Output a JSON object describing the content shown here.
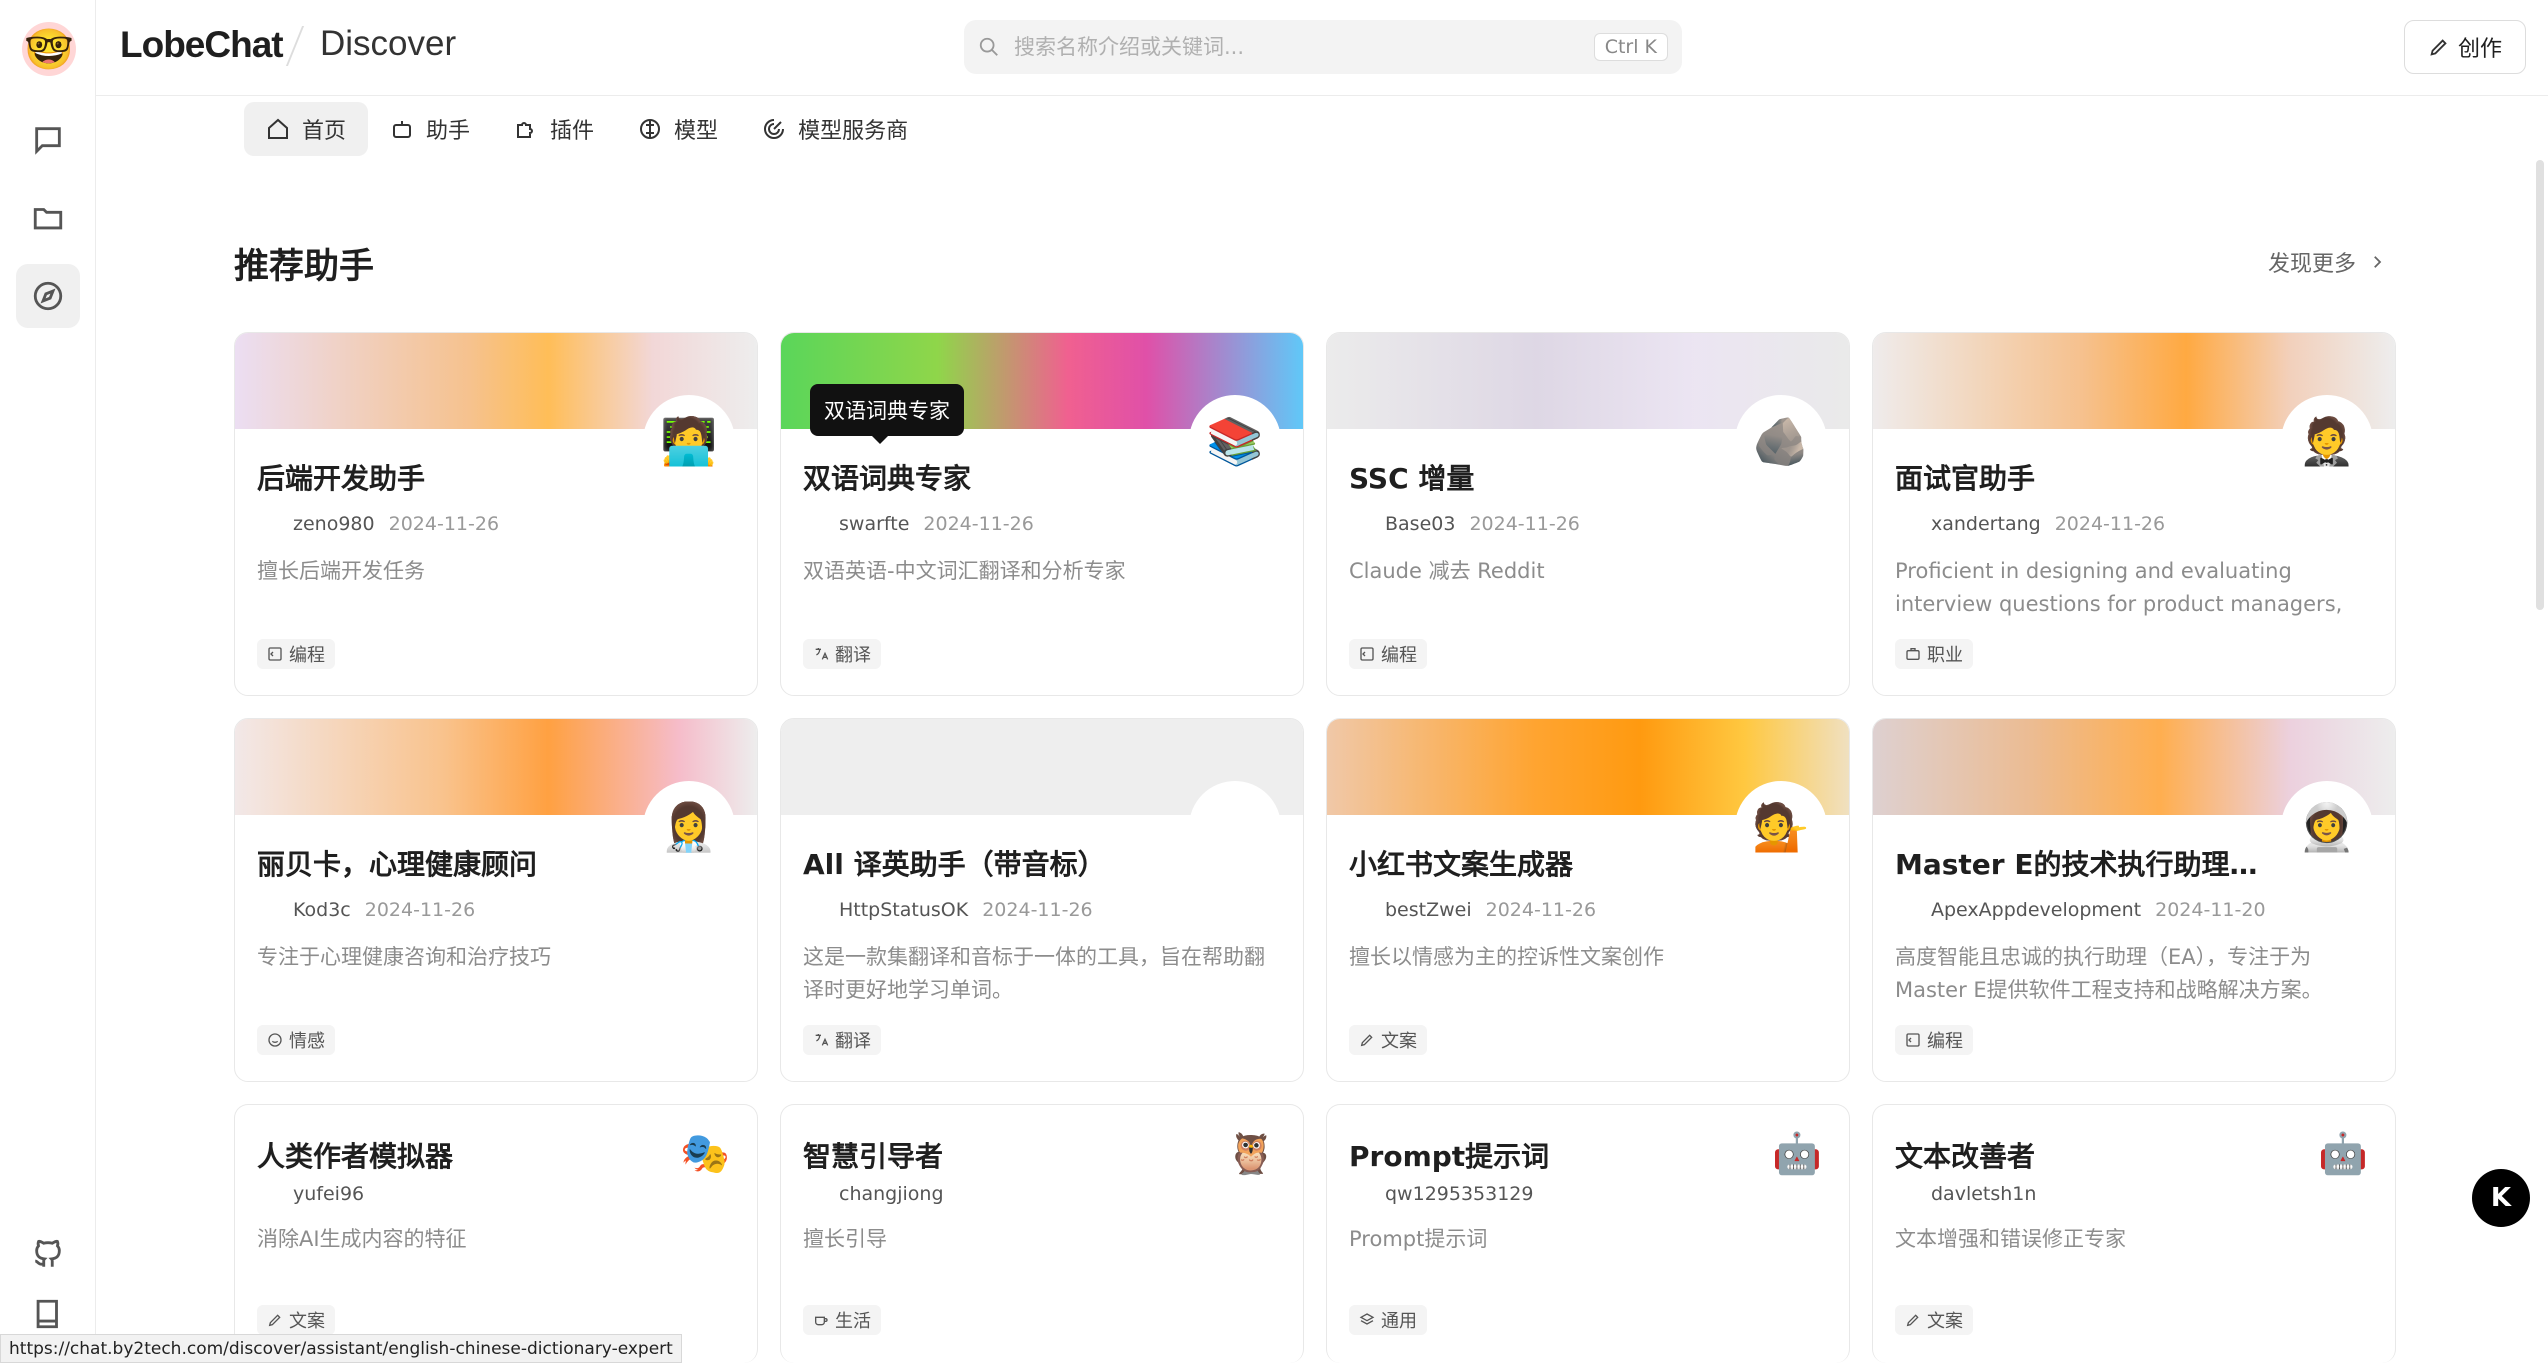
{
  "app": {
    "brand": "LobeChat",
    "section": "Discover"
  },
  "search": {
    "placeholder": "搜索名称介绍或关键词...",
    "shortcut": "Ctrl K"
  },
  "toolbar": {
    "create_label": "创作"
  },
  "nav": {
    "tabs": [
      {
        "label": "首页",
        "icon": "home-icon",
        "active": true
      },
      {
        "label": "助手",
        "icon": "bot-icon"
      },
      {
        "label": "插件",
        "icon": "puzzle-icon"
      },
      {
        "label": "模型",
        "icon": "brain-icon"
      },
      {
        "label": "模型服务商",
        "icon": "provider-icon"
      }
    ]
  },
  "section": {
    "title": "推荐助手",
    "more_label": "发现更多"
  },
  "tooltip": {
    "text": "双语词典专家"
  },
  "cards": [
    {
      "title": "后端开发助手",
      "author": "zeno980",
      "date": "2024-11-26",
      "desc": "擅长后端开发任务",
      "tag": "编程",
      "avatar": "🧑‍💻"
    },
    {
      "title": "双语词典专家",
      "author": "swarfte",
      "date": "2024-11-26",
      "desc": "双语英语-中文词汇翻译和分析专家",
      "tag": "翻译",
      "avatar": "📚"
    },
    {
      "title": "SSC 增量",
      "author": "Base03",
      "date": "2024-11-26",
      "desc": "Claude 减去 Reddit",
      "tag": "编程",
      "avatar": "🪨"
    },
    {
      "title": "面试官助手",
      "author": "xandertang",
      "date": "2024-11-26",
      "desc": "Proficient in designing and evaluating interview questions for product managers, generating…",
      "tag": "职业",
      "avatar": "🤵"
    },
    {
      "title": "丽贝卡，心理健康顾问",
      "author": "Kod3c",
      "date": "2024-11-26",
      "desc": "专注于心理健康咨询和治疗技巧",
      "tag": "情感",
      "avatar": "👩‍⚕️"
    },
    {
      "title": "All 译英助手（带音标）",
      "author": "HttpStatusOK",
      "date": "2024-11-26",
      "desc": "这是一款集翻译和音标于一体的工具，旨在帮助翻译时更好地学习单词。",
      "tag": "翻译",
      "avatar": ""
    },
    {
      "title": "小红书文案生成器",
      "author": "bestZwei",
      "date": "2024-11-26",
      "desc": "擅长以情感为主的控诉性文案创作",
      "tag": "文案",
      "avatar": "💁"
    },
    {
      "title": "Master E的技术执行助理（…",
      "author": "ApexAppdevelopment",
      "date": "2024-11-20",
      "desc": "高度智能且忠诚的执行助理（EA），专注于为 Master E提供软件工程支持和战略解决方案。",
      "tag": "编程",
      "avatar": "👩‍🚀"
    },
    {
      "title": "人类作者模拟器",
      "author": "yufei96",
      "date": "",
      "desc": "消除AI生成内容的特征",
      "tag": "文案",
      "avatar": "🎭"
    },
    {
      "title": "智慧引导者",
      "author": "changjiong",
      "date": "",
      "desc": "擅长引导",
      "tag": "生活",
      "avatar": "🦉"
    },
    {
      "title": "Prompt提示词",
      "author": "qw1295353129",
      "date": "",
      "desc": "Prompt提示词",
      "tag": "通用",
      "avatar": "🤖"
    },
    {
      "title": "文本改善者",
      "author": "davletsh1n",
      "date": "",
      "desc": "文本增强和错误修正专家",
      "tag": "文案",
      "avatar": "🤖"
    }
  ],
  "status": {
    "url": "https://chat.by2tech.com/discover/assistant/english-chinese-dictionary-expert"
  },
  "fab": {
    "label": "K"
  },
  "colors": {
    "accent": "#1f1f1f",
    "tooltip_bg": "#111111"
  }
}
